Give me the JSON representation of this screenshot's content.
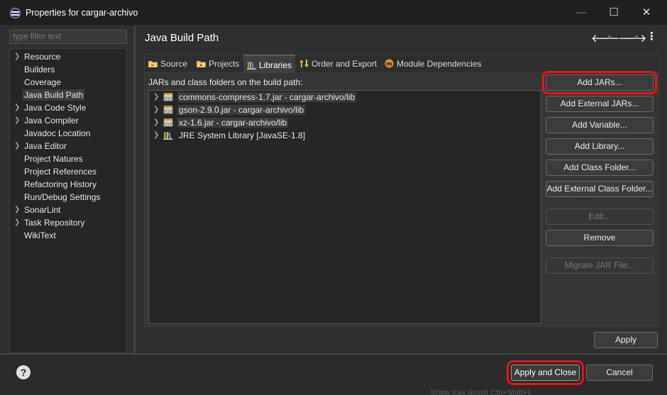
{
  "window": {
    "title": "Properties for cargar-archivo",
    "minimize_glyph": "—",
    "maximize_glyph": "☐",
    "close_glyph": "✕"
  },
  "sidebar": {
    "filter_placeholder": "type filter text",
    "items": [
      {
        "label": "Resource",
        "expandable": true
      },
      {
        "label": "Builders",
        "expandable": false
      },
      {
        "label": "Coverage",
        "expandable": false
      },
      {
        "label": "Java Build Path",
        "expandable": false,
        "selected": true
      },
      {
        "label": "Java Code Style",
        "expandable": true
      },
      {
        "label": "Java Compiler",
        "expandable": true
      },
      {
        "label": "Javadoc Location",
        "expandable": false
      },
      {
        "label": "Java Editor",
        "expandable": true
      },
      {
        "label": "Project Natures",
        "expandable": false
      },
      {
        "label": "Project References",
        "expandable": false
      },
      {
        "label": "Refactoring History",
        "expandable": false
      },
      {
        "label": "Run/Debug Settings",
        "expandable": false
      },
      {
        "label": "SonarLint",
        "expandable": true
      },
      {
        "label": "Task Repository",
        "expandable": true
      },
      {
        "label": "WikiText",
        "expandable": false
      }
    ]
  },
  "header": {
    "title": "Java Build Path",
    "back_glyph": "🡐",
    "forward_glyph": "🡒",
    "dropdown_glyph": "▼",
    "menu_glyph": "⋮"
  },
  "tabs": [
    {
      "label": "Source",
      "icon": "source-folder-icon"
    },
    {
      "label": "Projects",
      "icon": "projects-folder-icon"
    },
    {
      "label": "Libraries",
      "icon": "libraries-icon",
      "active": true
    },
    {
      "label": "Order and Export",
      "icon": "order-export-icon"
    },
    {
      "label": "Module Dependencies",
      "icon": "module-icon"
    }
  ],
  "libraries": {
    "label": "JARs and class folders on the build path:",
    "entries": [
      {
        "label": "commons-compress-1.7.jar - cargar-archivo/lib",
        "icon": "jar-icon"
      },
      {
        "label": "gson-2.9.0.jar - cargar-archivo/lib",
        "icon": "jar-icon"
      },
      {
        "label": "xz-1.6.jar - cargar-archivo/lib",
        "icon": "jar-icon"
      },
      {
        "label": "JRE System Library [JavaSE-1.8]",
        "icon": "library-icon"
      }
    ],
    "buttons": {
      "add_jars": "Add JARs...",
      "add_external_jars": "Add External JARs...",
      "add_variable": "Add Variable...",
      "add_library": "Add Library...",
      "add_class_folder": "Add Class Folder...",
      "add_external_class_folder": "Add External Class Folder...",
      "edit": "Edit...",
      "remove": "Remove",
      "migrate_jar": "Migrate JAR File..."
    }
  },
  "apply": "Apply",
  "footer": {
    "help_glyph": "?",
    "apply_and_close": "Apply and Close",
    "cancel": "Cancel",
    "key_assist": "Show Key Assist   Ctrl+Shift+L"
  },
  "colors": {
    "highlight_box": "#e8121b",
    "background": "#2f2f2f"
  }
}
